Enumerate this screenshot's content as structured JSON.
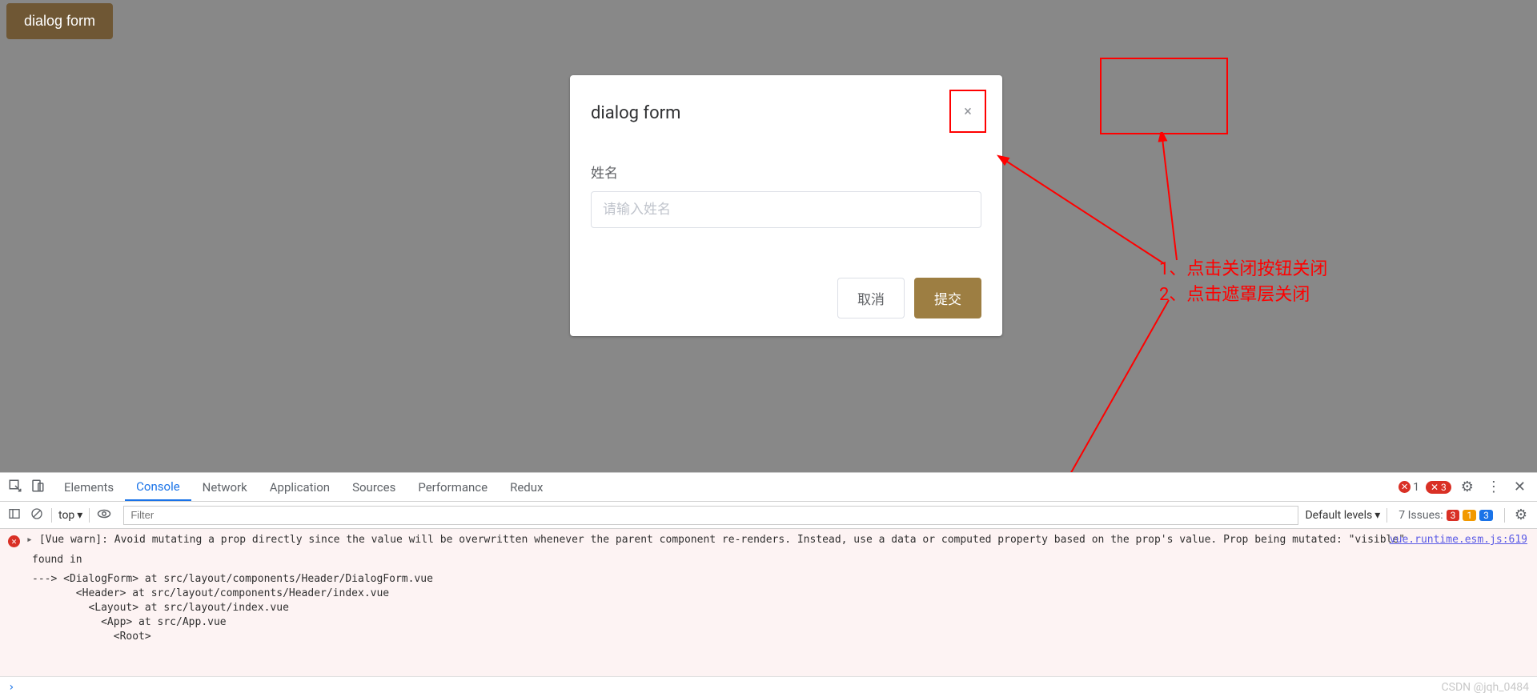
{
  "app": {
    "trigger_label": "dialog form",
    "dialog": {
      "title": "dialog form",
      "close_icon": "×",
      "form": {
        "name_label": "姓名",
        "name_placeholder": "请输入姓名"
      },
      "cancel_label": "取消",
      "submit_label": "提交"
    }
  },
  "annotations": {
    "line1": "1、点击关闭按钮关闭",
    "line2": "2、点击遮罩层关闭"
  },
  "devtools": {
    "tabs": [
      "Elements",
      "Console",
      "Network",
      "Application",
      "Sources",
      "Performance",
      "Redux"
    ],
    "active_tab": "Console",
    "top_right": {
      "error_count": "1",
      "msg_count": "3"
    },
    "toolbar": {
      "context": "top",
      "filter_placeholder": "Filter",
      "levels": "Default levels",
      "issues_label": "7 Issues:",
      "issue_red": "3",
      "issue_yellow": "1",
      "issue_blue": "3"
    },
    "console": {
      "warn_prefix": "[Vue warn]:",
      "message": "Avoid mutating a prop directly since the value will be overwritten whenever the parent component re-renders. Instead, use a data or computed property based on the prop's value. Prop being mutated: \"visible\"",
      "source_link": "vue.runtime.esm.js:619",
      "found_in": "found in",
      "trace": "---> <DialogForm> at src/layout/components/Header/DialogForm.vue\n       <Header> at src/layout/components/Header/index.vue\n         <Layout> at src/layout/index.vue\n           <App> at src/App.vue\n             <Root>"
    }
  },
  "watermark": "CSDN @jqh_0484"
}
